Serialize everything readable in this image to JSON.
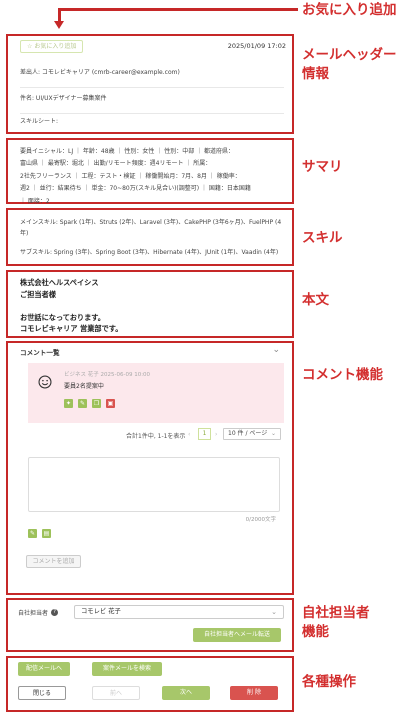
{
  "callouts": {
    "favorite": "お気に入り追加",
    "mail_header": "メールヘッダー\n情報",
    "summary": "サマリ",
    "skill": "スキル",
    "body": "本文",
    "comment": "コメント機能",
    "assignee": "自社担当者\n機能",
    "operations": "各種操作"
  },
  "header": {
    "favorite_label": "お気に入り追加",
    "date": "2025/01/09 17:02",
    "sender": "差出人: コモレビキャリア (cmrb-career@example.com)",
    "subject": "件名: UI/UXデザイナー募集案件",
    "skillsheet": "スキルシート:"
  },
  "summary": {
    "lines": [
      "要員イニシャル：LJ  ｜  年齢：48歳  ｜  性別：女性  ｜  性別：中部  ｜  都道府県：",
      "富山県  ｜  最寄駅：堀北  ｜  出勤/リモート頻度：週4リモート  ｜  所属：",
      "2社先フリーランス  ｜  工程：テスト・検証  ｜  稼働開始月：7月、8月  ｜  稼働率：",
      "週2  ｜  並行：結果待ち  ｜  単金：70~80万(スキル見合い)(調整可)  ｜  国籍：日本国籍",
      "｜  面接：2"
    ]
  },
  "skills": {
    "main": "メインスキル:  Spark (1年)、Struts (2年)、Laravel (3年)、CakePHP (3年6ヶ月)、FuelPHP (4年)",
    "sub": "サブスキル:  Spring (3年)、Spring Boot (3年)、Hibernate (4年)、JUnit (1年)、Vaadin (4年)"
  },
  "body": {
    "lines": [
      "株式会社ヘルスペイシス",
      "ご担当者様",
      "",
      "お世話になっております。",
      "コモレビキャリア 営業部です。"
    ]
  },
  "comments": {
    "title": "コメント一覧",
    "item_meta": "ビジネス 花子  2025-06-09 10:00",
    "item_text": "要員2名提案中",
    "pager_summary": "合計1件中, 1-1を表示",
    "page": "1",
    "per_page": "10 件 / ページ",
    "counter": "0/2000文字",
    "add_label": "コメントを追加"
  },
  "assignee": {
    "label": "自社担当者",
    "value": "コモレビ 花子",
    "transfer_label": "自社担当者へメール転送"
  },
  "operations": {
    "forward_label": "配信メールへ",
    "search_label": "案件メールを検索",
    "close_label": "閉じる",
    "prev_label": "前へ",
    "next_label": "次へ",
    "delete_label": "削 除"
  },
  "colors": {
    "annotation_red": "#c62828",
    "accent_green": "#a7c76a",
    "delete_red": "#d9534f",
    "comment_bg": "#fce8ec"
  }
}
